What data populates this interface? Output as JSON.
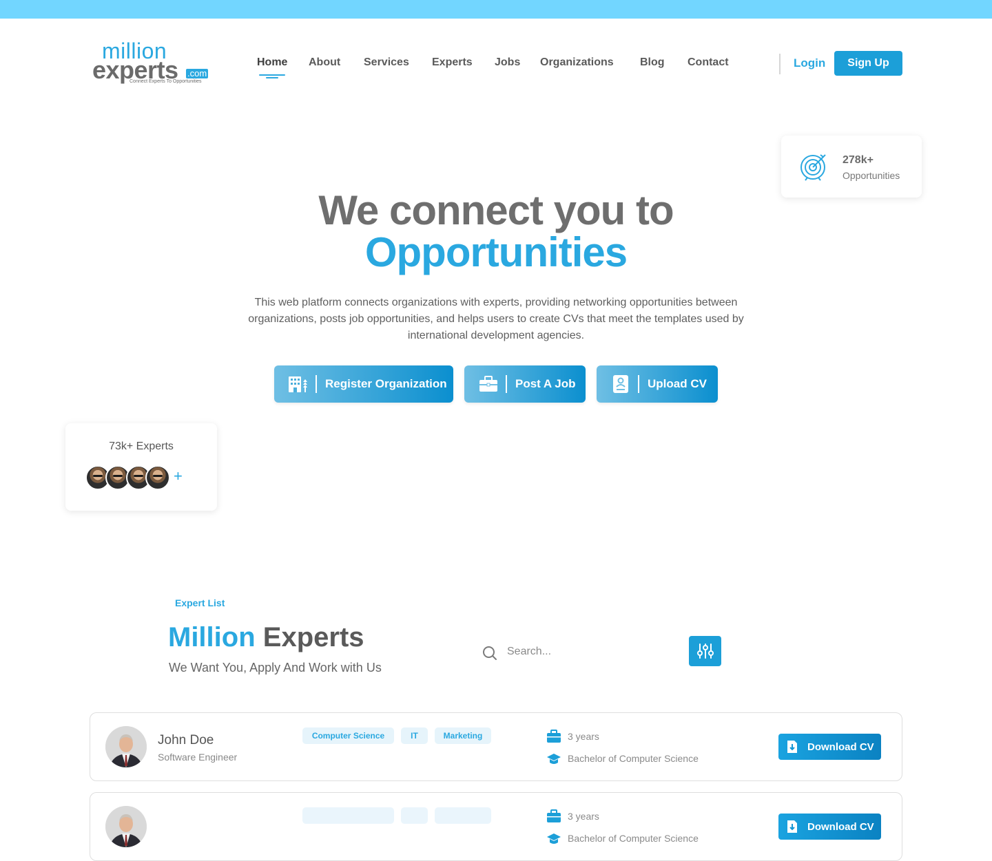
{
  "logo": {
    "million": "million",
    "experts": "experts",
    "com": ".com",
    "tagline": "Connect Experts To Opportunities"
  },
  "nav": {
    "items": [
      {
        "label": "Home"
      },
      {
        "label": "About"
      },
      {
        "label": "Services"
      },
      {
        "label": "Experts"
      },
      {
        "label": "Jobs"
      },
      {
        "label": "Organizations"
      },
      {
        "label": "Blog"
      },
      {
        "label": "Contact"
      }
    ],
    "active": "Home",
    "login": "Login",
    "signup": "Sign Up"
  },
  "stats": {
    "opportunities_value": "278k+",
    "opportunities_label": "Opportunities",
    "experts_label": "73k+ Experts",
    "experts_more": "+"
  },
  "hero": {
    "line1": "We connect you to",
    "line2": "Opportunities",
    "description": "This web platform connects organizations with experts, providing networking opportunities between organizations, posts job opportunities, and helps users to create CVs that meet the templates used by international development agencies.",
    "buttons": {
      "register": "Register Organization",
      "post_job": "Post A Job",
      "upload_cv": "Upload CV"
    }
  },
  "expert_list": {
    "tag": "Expert List",
    "title_blue": "Million",
    "title_gray": "Experts",
    "subtitle": "We Want You, Apply And Work with Us",
    "search_placeholder": "Search...",
    "experts": [
      {
        "name": "John Doe",
        "role": "Software Engineer",
        "tags": [
          "Computer Science",
          "IT",
          "Marketing"
        ],
        "experience": "3 years",
        "education": "Bachelor of Computer Science",
        "download": "Download CV"
      },
      {
        "name": "",
        "role": "",
        "tags": [
          "",
          "",
          ""
        ],
        "experience": "3 years",
        "education": "Bachelor of Computer Science",
        "download": "Download CV"
      }
    ]
  },
  "colors": {
    "accent": "#2aa8e0",
    "top_strip": "#72d6ff",
    "heading_gray": "#6e6e6e"
  }
}
